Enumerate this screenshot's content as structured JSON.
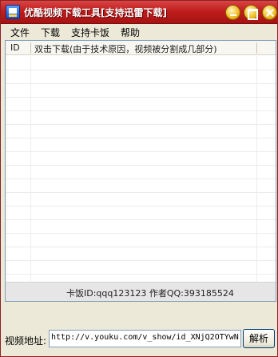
{
  "window": {
    "title": "优酷视频下载工具[支持迅雷下载]"
  },
  "menu": {
    "items": [
      "文件",
      "下载",
      "支持卡饭",
      "帮助"
    ]
  },
  "list": {
    "columns": [
      "ID",
      "双击下载(由于技术原因，视频被分割成几部分)"
    ]
  },
  "status": {
    "text": "卡饭ID:qqq123123 作者QQ:393185524"
  },
  "address": {
    "label": "视频地址:",
    "value": "http://v.youku.com/v_show/id_XNjQ2OTYwN",
    "button_label": "解析"
  }
}
